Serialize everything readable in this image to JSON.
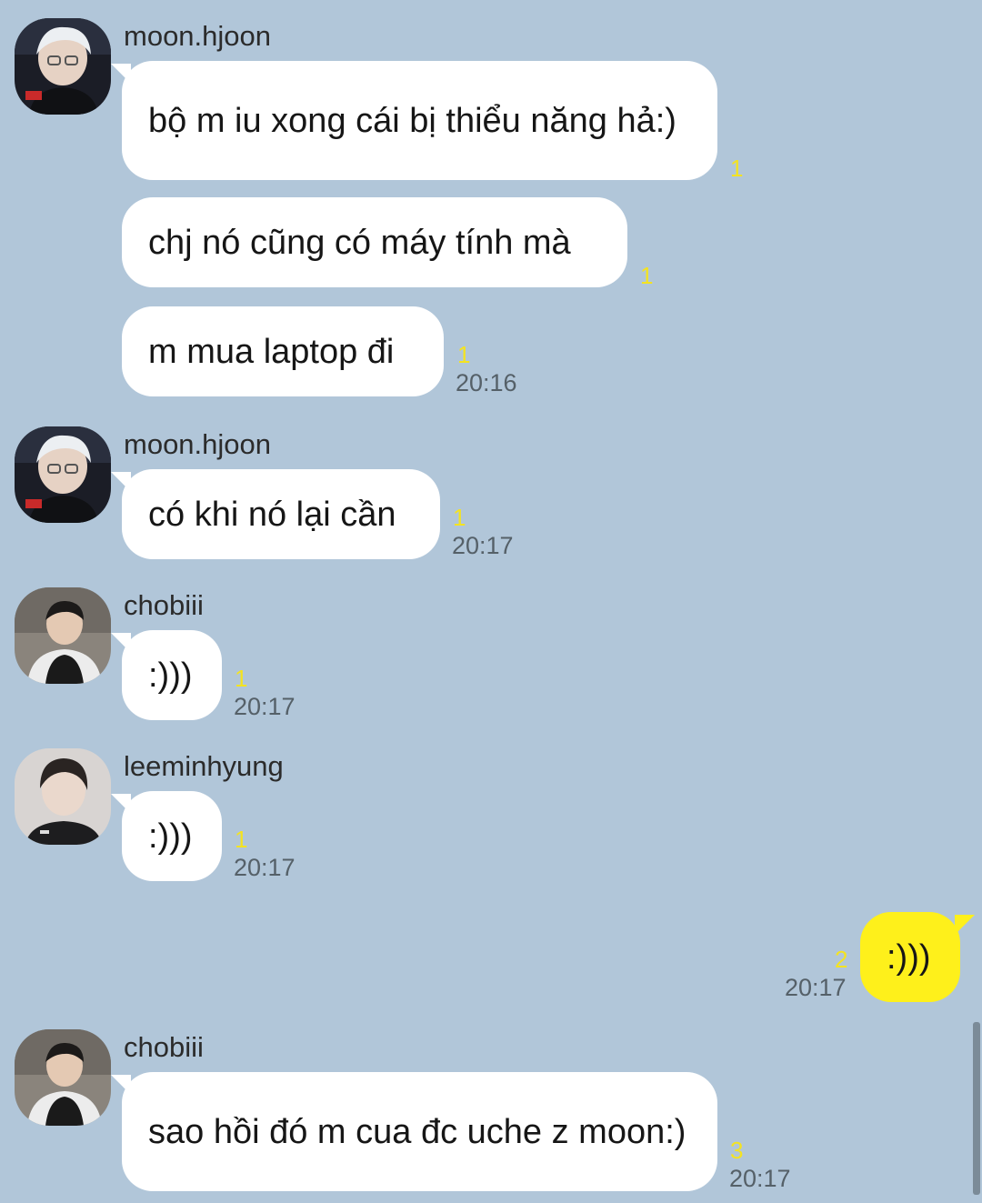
{
  "chat": {
    "messages": [
      {
        "sender": "moon.hjoon",
        "text": "bộ m iu xong cái bị thiểu năng hả:)",
        "unread": "1",
        "time": ""
      },
      {
        "sender": "",
        "text": "chj nó cũng có máy tính mà",
        "unread": "1",
        "time": ""
      },
      {
        "sender": "",
        "text": "m mua laptop đi",
        "unread": "1",
        "time": "20:16"
      },
      {
        "sender": "moon.hjoon",
        "text": "có khi nó lại cần",
        "unread": "1",
        "time": "20:17"
      },
      {
        "sender": "chobiii",
        "text": ":)))",
        "unread": "1",
        "time": "20:17"
      },
      {
        "sender": "leeminhyung",
        "text": ":)))",
        "unread": "1",
        "time": "20:17"
      },
      {
        "sender": "",
        "text": ":)))",
        "unread": "2",
        "time": "20:17",
        "outgoing": true
      },
      {
        "sender": "chobiii",
        "text": "sao hồi đó m cua đc uche z moon:)",
        "unread": "3",
        "time": "20:17"
      }
    ]
  },
  "colors": {
    "background": "#b1c6d9",
    "incoming_bubble": "#ffffff",
    "outgoing_bubble": "#fef01b",
    "unread_count": "#f4e321"
  },
  "icons": [
    "avatar-moon-hjoon",
    "avatar-chobiii",
    "avatar-leeminhyung"
  ]
}
